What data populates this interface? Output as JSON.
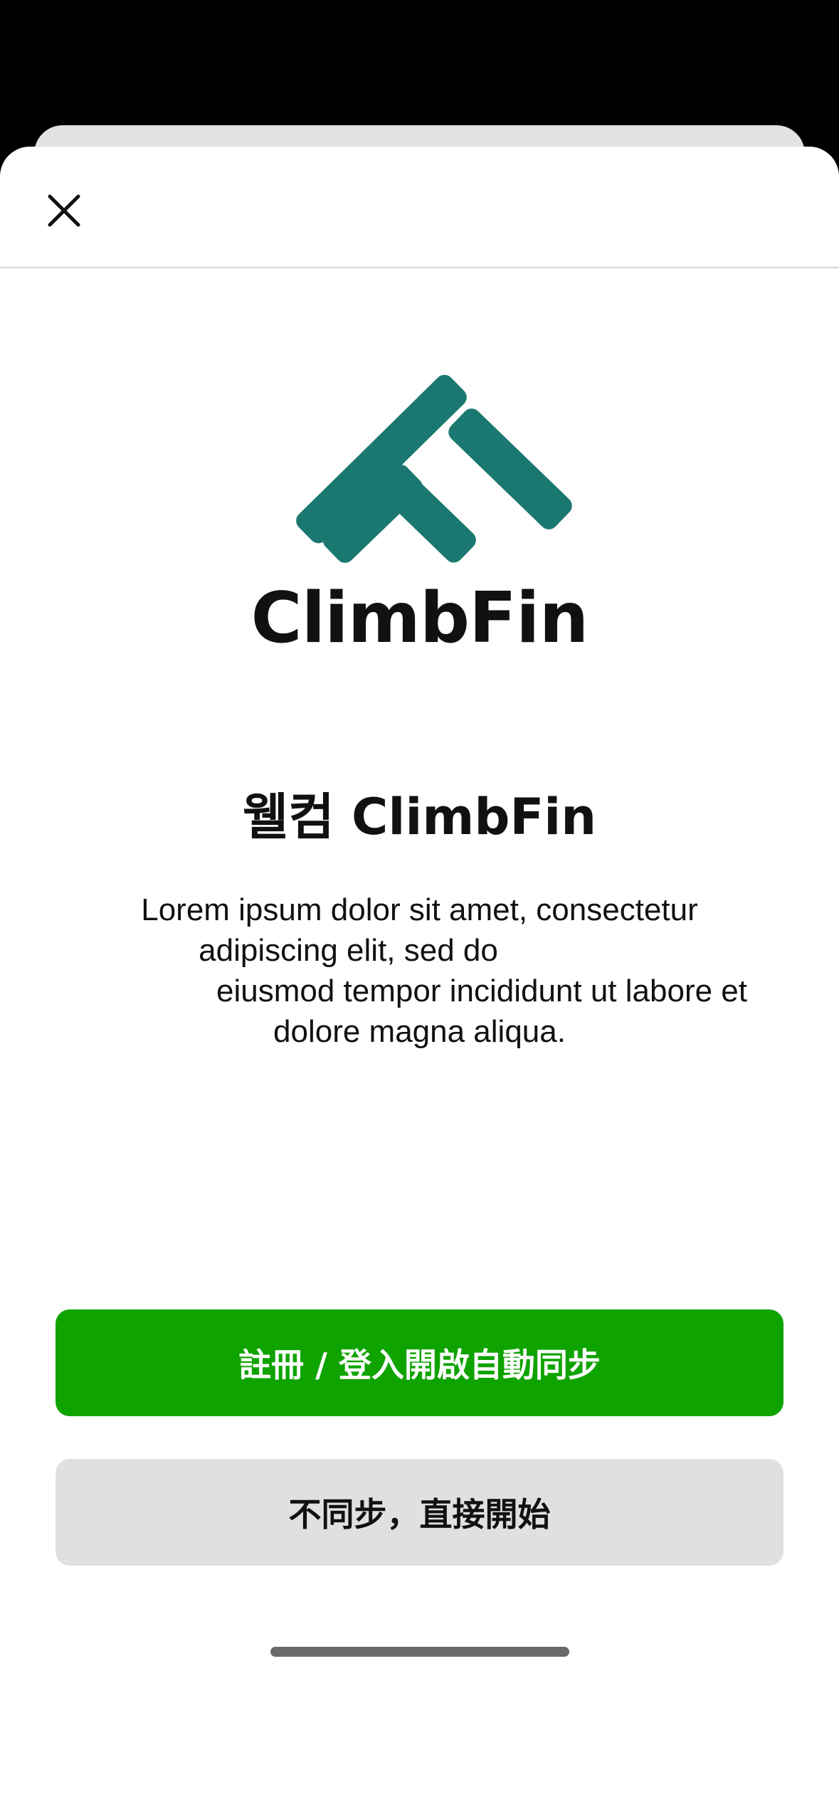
{
  "app": {
    "brand_name": "ClimbFin",
    "brand_color": "#1b7870"
  },
  "header": {
    "close_icon": "close-icon"
  },
  "welcome": {
    "title": "웰컴 ClimbFin",
    "description_lines": [
      "Lorem ipsum dolor sit amet, consectetur",
      "adipiscing elit, sed do",
      "eiusmod tempor incididunt ut labore et",
      "dolore magna aliqua."
    ]
  },
  "actions": {
    "primary_label": "註冊 / 登入開啟自動同步",
    "primary_color": "#0fa300",
    "secondary_label": "不同步，直接開始",
    "secondary_color": "#e0e0e0"
  }
}
